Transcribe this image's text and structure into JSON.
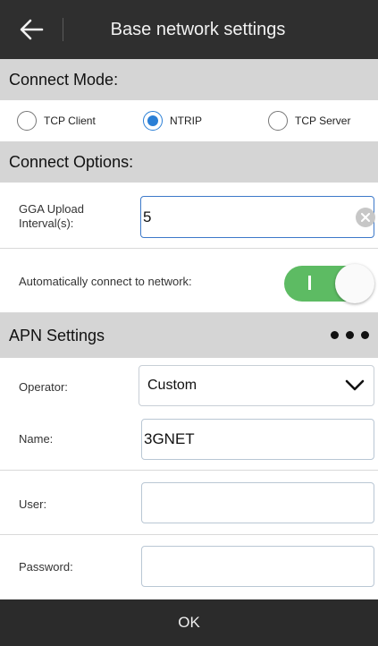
{
  "header": {
    "title": "Base network settings",
    "back_icon": "arrow-left-icon"
  },
  "connect_mode": {
    "title": "Connect Mode:",
    "options": [
      {
        "label": "TCP Client",
        "selected": false
      },
      {
        "label": "NTRIP",
        "selected": true
      },
      {
        "label": "TCP Server",
        "selected": false
      }
    ]
  },
  "connect_options": {
    "title": "Connect Options:",
    "gga_label": "GGA Upload Interval(s):",
    "gga_value": "5",
    "auto_connect_label": "Automatically connect to network:",
    "auto_connect_on": true,
    "toggle_mark": "I"
  },
  "apn": {
    "title": "APN Settings",
    "operator_label": "Operator:",
    "operator_value": "Custom",
    "name_label": "Name:",
    "name_value": "3GNET",
    "user_label": "User:",
    "user_value": "",
    "password_label": "Password:",
    "password_value": ""
  },
  "footer": {
    "ok_label": "OK"
  },
  "colors": {
    "accent": "#2a7fd6",
    "toggle_on": "#5dbb63",
    "header_bg": "#2f2f2f"
  }
}
